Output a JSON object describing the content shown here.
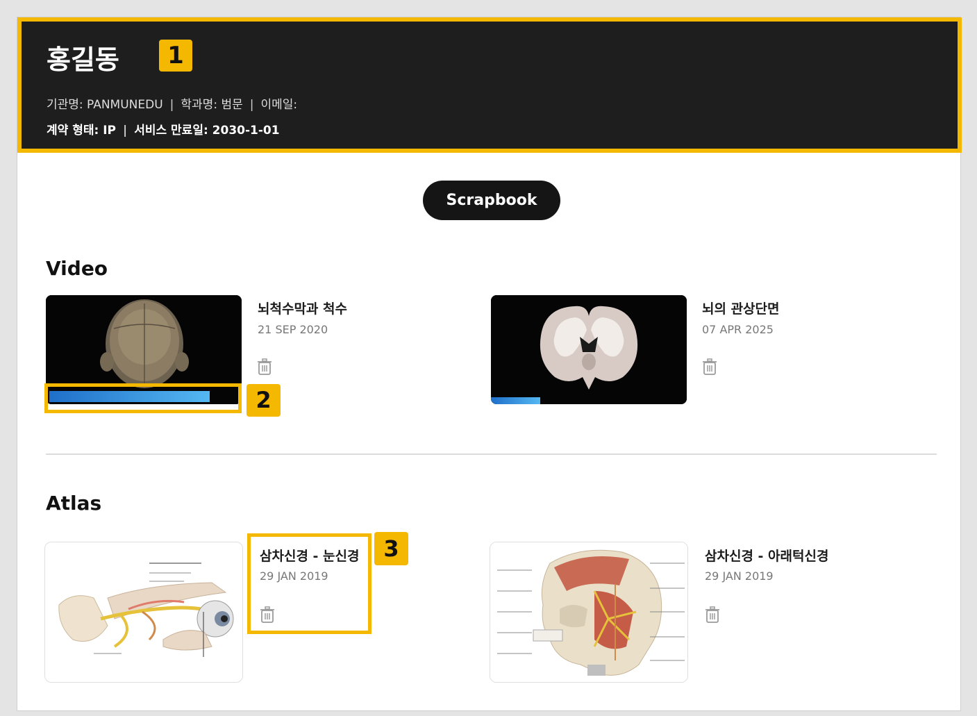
{
  "profile": {
    "name": "홍길동",
    "callout": "1",
    "institution": "기관명: PANMUNEDU",
    "department": "학과명: 범문",
    "email": "이메일:",
    "contract": "계약 형태: IP",
    "expiry": "서비스 만료일: 2030-1-01",
    "separator": "|"
  },
  "scrapbook_label": "Scrapbook",
  "video": {
    "title": "Video",
    "items": [
      {
        "title": "뇌척수막과 척수",
        "date": "21 SEP 2020",
        "progress": 0.85,
        "callout": "2"
      },
      {
        "title": "뇌의 관상단면",
        "date": "07 APR 2025",
        "progress": 0.25
      }
    ]
  },
  "atlas": {
    "title": "Atlas",
    "items": [
      {
        "title": "삼차신경 - 눈신경",
        "date": "29 JAN 2019",
        "callout": "3"
      },
      {
        "title": "삼차신경 - 아래턱신경",
        "date": "29 JAN 2019"
      }
    ]
  },
  "colors": {
    "accent": "#f5b800",
    "header_bg": "#1e1e1e",
    "progress": "#3a9ae6"
  },
  "icons": {
    "delete": "trash-icon"
  }
}
